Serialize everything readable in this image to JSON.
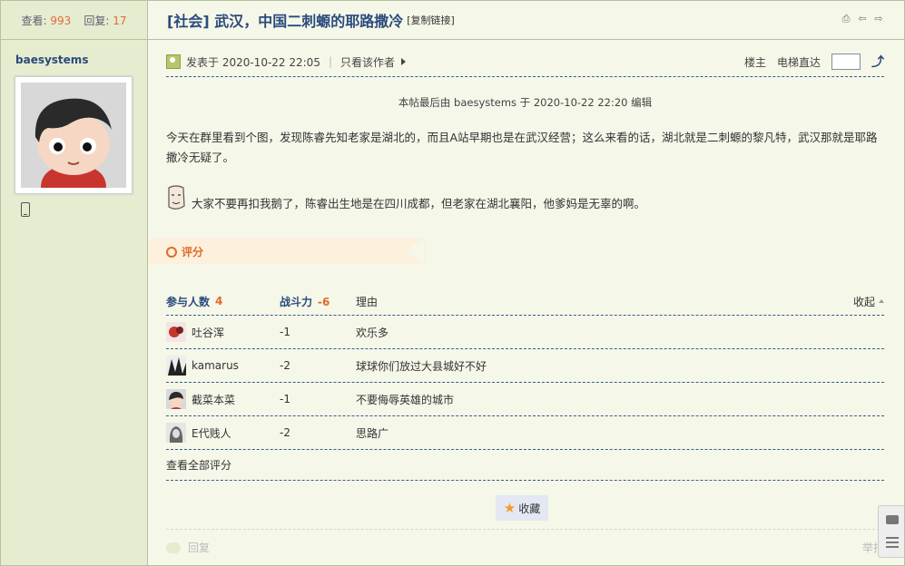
{
  "sidebar": {
    "views_label": "查看:",
    "views": "993",
    "replies_label": "回复:",
    "replies": "17",
    "author": "baesystems"
  },
  "thread": {
    "title": "[社会] 武汉，中国二刺螈的耶路撒冷",
    "copy_link": "[复制链接]"
  },
  "post": {
    "posted_at": "发表于 2020-10-22 22:05",
    "author_only": "只看该作者",
    "floor_label": "楼主",
    "jump_label": "电梯直达",
    "edited_note": "本帖最后由 baesystems 于 2020-10-22 22:20 编辑",
    "paragraph1": "今天在群里看到个图，发现陈睿先知老家是湖北的，而且A站早期也是在武汉经营；这么来看的话，湖北就是二刺螈的黎凡特，武汉那就是耶路撒冷无疑了。",
    "paragraph2": "大家不要再扣我鹅了，陈睿出生地是在四川成都，但老家在湖北襄阳，他爹妈是无辜的啊。"
  },
  "rating": {
    "label": "评分",
    "participants_label": "参与人数",
    "participants": "4",
    "score_label": "战斗力",
    "score_total": "-6",
    "reason_label": "理由",
    "collapse_label": "收起",
    "rows": [
      {
        "user": "吐谷浑",
        "score": "-1",
        "reason": "欢乐多"
      },
      {
        "user": "kamarus",
        "score": "-2",
        "reason": "球球你们放过大县城好不好"
      },
      {
        "user": "截菜本菜",
        "score": "-1",
        "reason": "不要侮辱英雄的城市"
      },
      {
        "user": "E代贱人",
        "score": "-2",
        "reason": "思路广"
      }
    ],
    "view_all": "查看全部评分"
  },
  "actions": {
    "favorite": "收藏",
    "reply": "回复",
    "report": "举报"
  },
  "colors": {
    "accent": "#e06a2c",
    "title_blue": "#2a4b7d",
    "sidebar_bg": "#e5ecd0"
  }
}
